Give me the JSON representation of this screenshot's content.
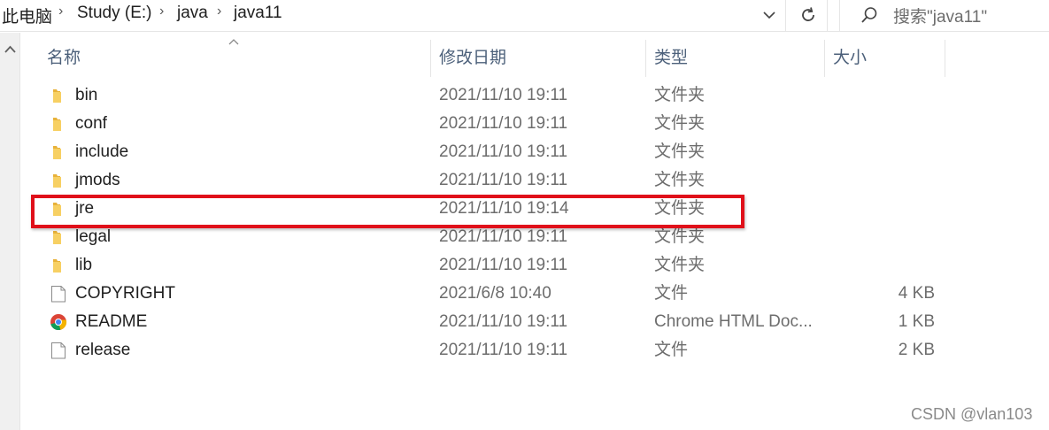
{
  "address_bar": {
    "crumbs": [
      "此电脑",
      "Study (E:)",
      "java",
      "java11"
    ],
    "separator": "›"
  },
  "search": {
    "placeholder": "搜索\"java11\""
  },
  "columns": {
    "name": "名称",
    "date": "修改日期",
    "type": "类型",
    "size": "大小"
  },
  "files": [
    {
      "name": "bin",
      "date": "2021/11/10 19:11",
      "type": "文件夹",
      "size": "",
      "icon": "folder-icon"
    },
    {
      "name": "conf",
      "date": "2021/11/10 19:11",
      "type": "文件夹",
      "size": "",
      "icon": "folder-icon"
    },
    {
      "name": "include",
      "date": "2021/11/10 19:11",
      "type": "文件夹",
      "size": "",
      "icon": "folder-icon"
    },
    {
      "name": "jmods",
      "date": "2021/11/10 19:11",
      "type": "文件夹",
      "size": "",
      "icon": "folder-icon"
    },
    {
      "name": "jre",
      "date": "2021/11/10 19:14",
      "type": "文件夹",
      "size": "",
      "icon": "folder-icon"
    },
    {
      "name": "legal",
      "date": "2021/11/10 19:11",
      "type": "文件夹",
      "size": "",
      "icon": "folder-icon"
    },
    {
      "name": "lib",
      "date": "2021/11/10 19:11",
      "type": "文件夹",
      "size": "",
      "icon": "folder-icon"
    },
    {
      "name": "COPYRIGHT",
      "date": "2021/6/8 10:40",
      "type": "文件",
      "size": "4 KB",
      "icon": "file-icon"
    },
    {
      "name": "README",
      "date": "2021/11/10 19:11",
      "type": "Chrome HTML Doc...",
      "size": "1 KB",
      "icon": "chrome-icon"
    },
    {
      "name": "release",
      "date": "2021/11/10 19:11",
      "type": "文件",
      "size": "2 KB",
      "icon": "file-icon"
    }
  ],
  "highlighted_item": "jre",
  "colors": {
    "highlight": "#e0101a",
    "folder": "#f4c542",
    "header_text": "#4c607a"
  },
  "watermark": "CSDN @vlan103"
}
